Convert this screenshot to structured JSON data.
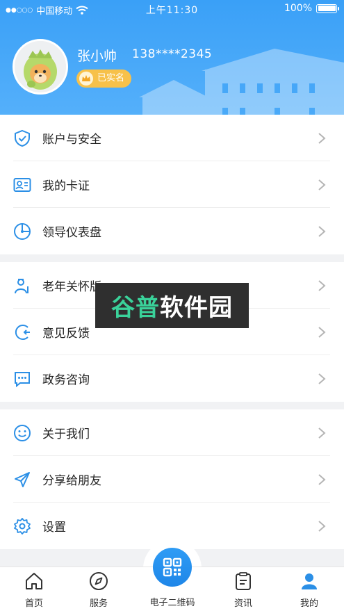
{
  "status_bar": {
    "signal_dots": "●●○○○",
    "carrier": "中国移动",
    "time": "上午11:30",
    "battery": "100%"
  },
  "profile": {
    "name": "张小帅",
    "phone": "138****2345",
    "verified_label": "已实名"
  },
  "menu_groups": [
    [
      {
        "label": "账户与安全",
        "icon": "shield-check-icon"
      },
      {
        "label": "我的卡证",
        "icon": "id-card-icon"
      },
      {
        "label": "领导仪表盘",
        "icon": "dashboard-icon"
      }
    ],
    [
      {
        "label": "老年关怀版",
        "icon": "elder-care-icon"
      },
      {
        "label": "意见反馈",
        "icon": "feedback-icon"
      },
      {
        "label": "政务咨询",
        "icon": "chat-icon"
      }
    ],
    [
      {
        "label": "关于我们",
        "icon": "smile-icon"
      },
      {
        "label": "分享给朋友",
        "icon": "share-icon"
      },
      {
        "label": "设置",
        "icon": "gear-icon"
      }
    ]
  ],
  "watermark": {
    "part_a": "谷普",
    "part_b": "软件园"
  },
  "tabbar": {
    "items": [
      {
        "label": "首页",
        "icon": "home-icon"
      },
      {
        "label": "服务",
        "icon": "compass-icon"
      },
      {
        "label": "电子二维码",
        "icon": "qr-code-icon"
      },
      {
        "label": "资讯",
        "icon": "news-icon"
      },
      {
        "label": "我的",
        "icon": "user-icon"
      }
    ],
    "active": "我的"
  },
  "colors": {
    "primary": "#3aa0f7",
    "icon_blue": "#2b8fe6",
    "badge": "#f7c14a",
    "watermark_green": "#3ad29a"
  }
}
